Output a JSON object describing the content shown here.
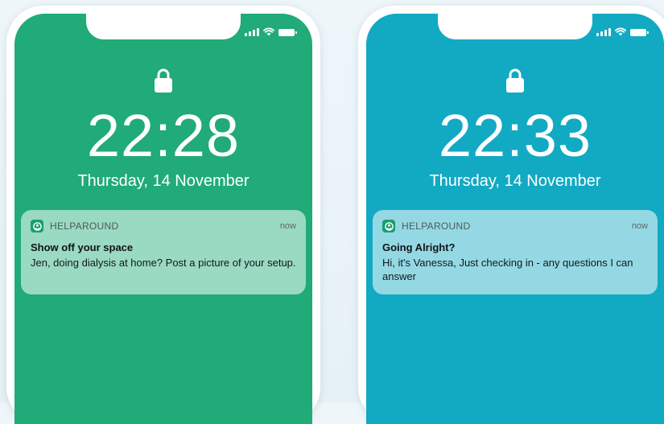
{
  "phones": [
    {
      "background_color": "#20ab78",
      "time": "22:28",
      "date": "Thursday, 14 November",
      "notification": {
        "app_name": "HELPAROUND",
        "time": "now",
        "title": "Show off your space",
        "body": "Jen, doing dialysis at home? Post a picture of your setup."
      }
    },
    {
      "background_color": "#12a9c3",
      "time": "22:33",
      "date": "Thursday, 14 November",
      "notification": {
        "app_name": "HELPAROUND",
        "time": "now",
        "title": "Going Alright?",
        "body": "Hi, it's Vanessa, Just checking in - any questions I can answer"
      }
    }
  ],
  "icons": {
    "lock": "lock-icon",
    "signal": "cellular-signal-icon",
    "wifi": "wifi-icon",
    "battery": "battery-icon",
    "app": "helparound-app-icon"
  }
}
